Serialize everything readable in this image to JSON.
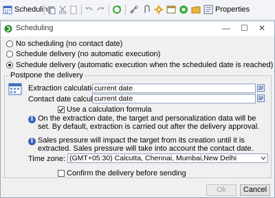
{
  "toolbar": {
    "scheduling_label": "Scheduling",
    "properties_label": "Properties",
    "icons": [
      "calendar-icon",
      "paste-icon",
      "cut-icon",
      "delete-icon",
      "undo-icon",
      "redo-icon",
      "refresh-icon",
      "link-icon",
      "attach-icon",
      "settings-icon",
      "form-icon",
      "status-icon",
      "folder-icon",
      "properties-icon"
    ]
  },
  "dialog": {
    "title": "Scheduling",
    "controls": {
      "minimize": "—",
      "maximize": "☐",
      "close": "✕"
    },
    "options": [
      {
        "label": "No scheduling (no contact date)",
        "selected": false
      },
      {
        "label": "Schedule delivery (no automatic execution)",
        "selected": false
      },
      {
        "label": "Schedule delivery (automatic execution when the scheduled date is reached)",
        "selected": true
      }
    ],
    "postpone": {
      "legend": "Postpone the delivery",
      "extraction_label": "Extraction calculation:",
      "extraction_value": "current date",
      "contact_label": "Contact date calculation:",
      "contact_value": "current date",
      "use_formula_label": "Use a calculation formula",
      "use_formula_checked": true,
      "info1": "On the extraction date, the target and personalization data will be set. By default, extraction is carried out after the delivery approval.",
      "info2": "Sales pressure will impact the target from its creation until it is extracted. Sales pressure will take into account the contact date.",
      "timezone_label": "Time zone:",
      "timezone_value": "(GMT+05:30) Calcutta, Chennai, Mumbai,New Delhi",
      "confirm_label": "Confirm the delivery before sending",
      "confirm_checked": false
    },
    "buttons": {
      "ok": "Ok",
      "cancel": "Cancel"
    }
  }
}
